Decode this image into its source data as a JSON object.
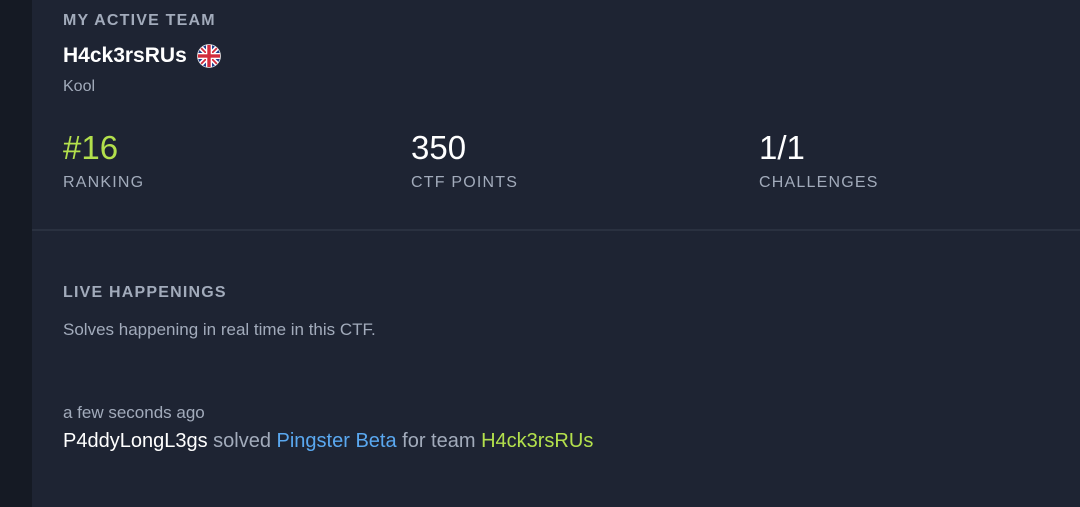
{
  "active_team": {
    "section_label": "MY ACTIVE TEAM",
    "team_name": "H4ck3rsRUs",
    "flag_icon": "uk-flag-icon",
    "subtitle": "Kool",
    "stats": {
      "ranking": {
        "value": "#16",
        "label": "RANKING"
      },
      "ctf_points": {
        "value": "350",
        "label": "CTF POINTS"
      },
      "challenges": {
        "value": "1/1",
        "label": "CHALLENGES"
      }
    }
  },
  "live": {
    "section_label": "LIVE HAPPENINGS",
    "description": "Solves happening in real time in this CTF.",
    "events": [
      {
        "time": "a few seconds ago",
        "user": "P4ddyLongL3gs",
        "verb": " solved ",
        "challenge": "Pingster Beta",
        "connector": " for team ",
        "team": "H4ck3rsRUs"
      }
    ]
  },
  "colors": {
    "accent_green": "#b3e04c",
    "link_blue": "#5aa8f0",
    "panel_bg": "#1e2433",
    "muted_text": "#a2abbb"
  }
}
